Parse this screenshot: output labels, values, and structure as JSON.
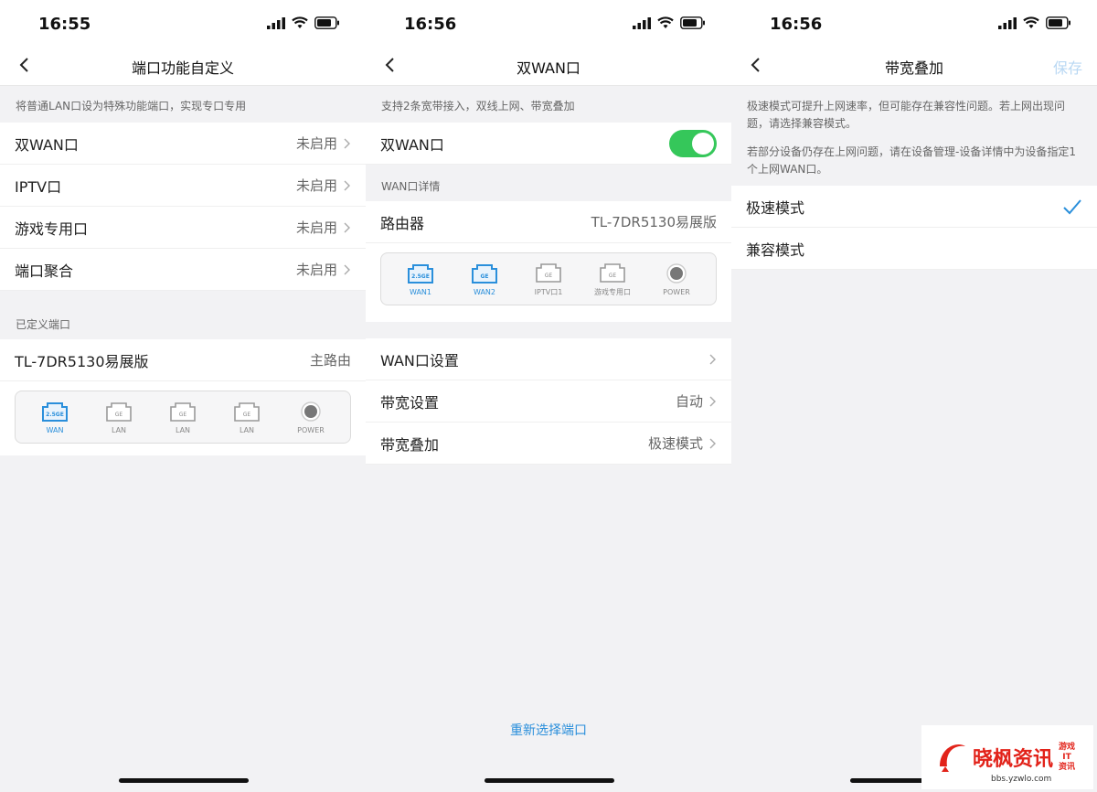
{
  "screens": [
    {
      "time": "16:55",
      "title": "端口功能自定义",
      "hint": "将普通LAN口设为特殊功能端口，实现专口专用",
      "rows": [
        {
          "label": "双WAN口",
          "value": "未启用"
        },
        {
          "label": "IPTV口",
          "value": "未启用"
        },
        {
          "label": "游戏专用口",
          "value": "未启用"
        },
        {
          "label": "端口聚合",
          "value": "未启用"
        }
      ],
      "section_title": "已定义端口",
      "device_row": {
        "label": "TL-7DR5130易展版",
        "value": "主路由"
      },
      "ports": [
        {
          "badge": "2.5GE",
          "label": "WAN"
        },
        {
          "badge": "GE",
          "label": "LAN"
        },
        {
          "badge": "GE",
          "label": "LAN"
        },
        {
          "badge": "GE",
          "label": "LAN"
        }
      ],
      "power_label": "POWER"
    },
    {
      "time": "16:56",
      "title": "双WAN口",
      "hint": "支持2条宽带接入，双线上网、带宽叠加",
      "toggle_row": {
        "label": "双WAN口",
        "on": true
      },
      "section_title": "WAN口详情",
      "device_row": {
        "label": "路由器",
        "value": "TL-7DR5130易展版"
      },
      "ports": [
        {
          "badge": "2.5GE",
          "label": "WAN1"
        },
        {
          "badge": "GE",
          "label": "WAN2"
        },
        {
          "badge": "GE",
          "label": "IPTV口1"
        },
        {
          "badge": "GE",
          "label": "游戏专用口"
        }
      ],
      "power_label": "POWER",
      "rows": [
        {
          "label": "WAN口设置",
          "value": ""
        },
        {
          "label": "带宽设置",
          "value": "自动"
        },
        {
          "label": "带宽叠加",
          "value": "极速模式"
        }
      ],
      "bottom_link": "重新选择端口"
    },
    {
      "time": "16:56",
      "title": "带宽叠加",
      "action": "保存",
      "hint1": "极速模式可提升上网速率，但可能存在兼容性问题。若上网出现问题，请选择兼容模式。",
      "hint2": "若部分设备仍存在上网问题，请在设备管理-设备详情中为设备指定1个上网WAN口。",
      "options": [
        {
          "label": "极速模式",
          "selected": true
        },
        {
          "label": "兼容模式",
          "selected": false
        }
      ]
    }
  ],
  "watermark": {
    "main": "晓枫资讯",
    "side1": "游戏",
    "side2": "IT",
    "side3": "资讯",
    "url": "bbs.yzwlo.com"
  },
  "colors": {
    "accent": "#2a8fdb",
    "toggle_on": "#35c75a",
    "disabled_action": "#b9d8f3"
  }
}
